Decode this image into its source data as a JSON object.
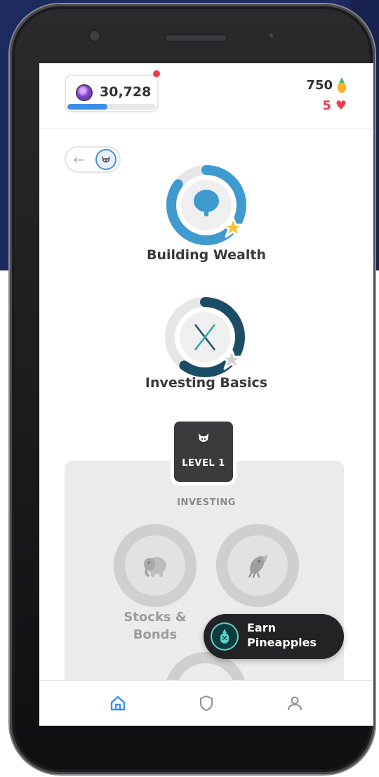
{
  "header": {
    "gem_value": "30,728",
    "gem_progress_fraction": 0.45,
    "pineapples": "750",
    "hearts": "5"
  },
  "courses": [
    {
      "title": "Building Wealth",
      "icon": "tree-icon",
      "progress": 0.85,
      "star": "gold-star-icon"
    },
    {
      "title": "Investing Basics",
      "icon": "x-icon",
      "progress": 0.6,
      "star": "gray-star-icon"
    }
  ],
  "level": {
    "label": "LEVEL 1",
    "section": "INVESTING"
  },
  "lessons": [
    {
      "title_line1": "Stocks &",
      "title_line2": "Bonds",
      "icon": "elephant-icon"
    },
    {
      "icon": "fish-icon"
    }
  ],
  "earn_button": {
    "line1": "Earn",
    "line2": "Pineapples"
  },
  "colors": {
    "accent_blue": "#3d8ee6",
    "ring_blue": "#3f9ad0",
    "ring_dark_teal": "#1b4d66",
    "heart_red": "#ef3d4f",
    "pineapple_yellow": "#f6b52b"
  },
  "nav": [
    "home-icon",
    "shield-icon",
    "profile-icon"
  ]
}
